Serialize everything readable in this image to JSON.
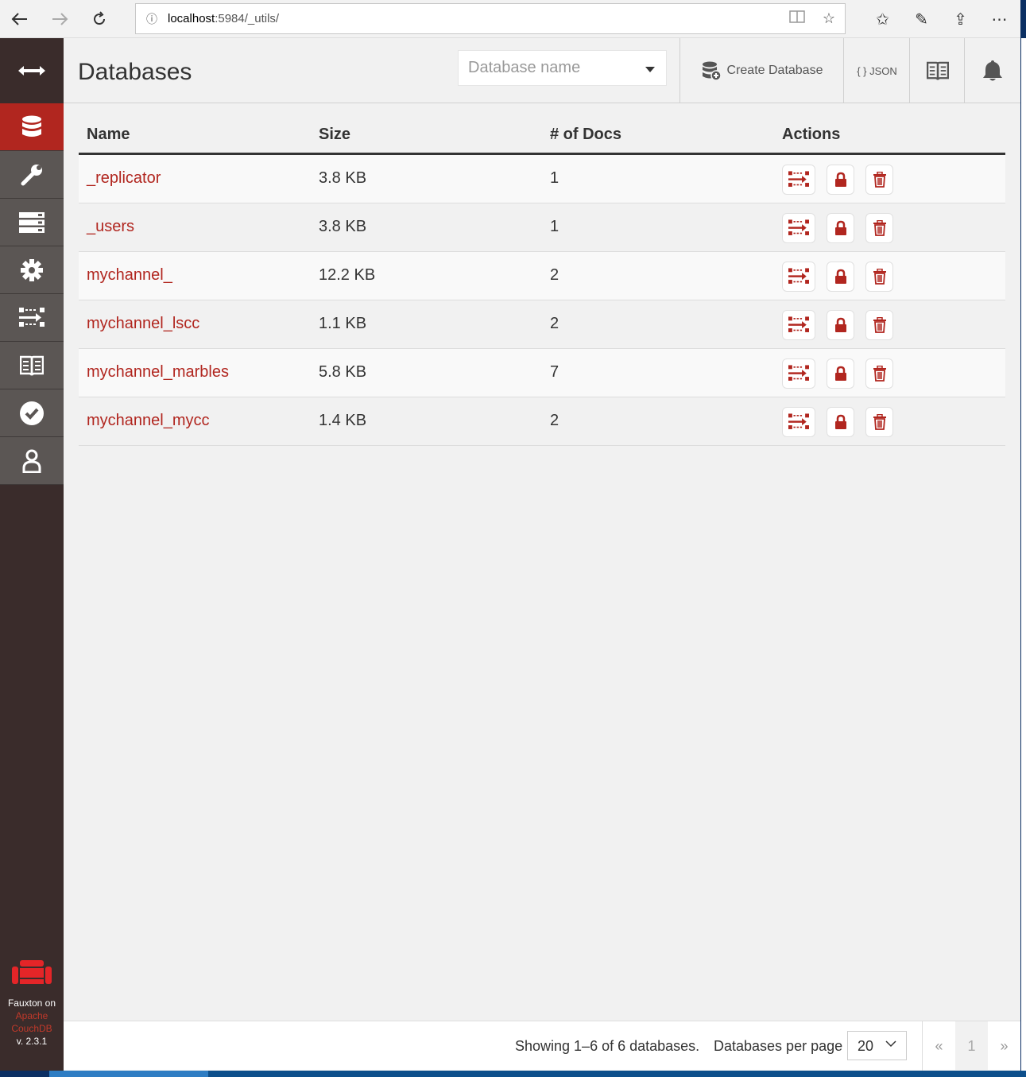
{
  "browser": {
    "url_host": "localhost",
    "url_path": ":5984/_utils/",
    "back_icon": "arrow-left-icon",
    "forward_icon": "arrow-right-icon",
    "refresh_icon": "refresh-icon"
  },
  "sidebar": {
    "items": [
      {
        "name": "databases",
        "icon": "database-icon",
        "active": true
      },
      {
        "name": "setup",
        "icon": "wrench-icon"
      },
      {
        "name": "active-tasks",
        "icon": "server-icon"
      },
      {
        "name": "config",
        "icon": "gear-icon"
      },
      {
        "name": "replication",
        "icon": "replication-icon"
      },
      {
        "name": "documentation",
        "icon": "book-icon"
      },
      {
        "name": "verify",
        "icon": "check-circle-icon"
      },
      {
        "name": "user",
        "icon": "user-icon"
      }
    ],
    "footer_line1": "Fauxton on",
    "footer_apache": "Apache",
    "footer_couchdb": "CouchDB",
    "footer_version": "v. 2.3.1"
  },
  "header": {
    "title": "Databases",
    "search_placeholder": "Database name",
    "create_label": "Create Database",
    "json_label": "{ } JSON"
  },
  "table": {
    "columns": [
      "Name",
      "Size",
      "# of Docs",
      "Actions"
    ],
    "rows": [
      {
        "name": "_replicator",
        "size": "3.8 KB",
        "docs": "1"
      },
      {
        "name": "_users",
        "size": "3.8 KB",
        "docs": "1"
      },
      {
        "name": "mychannel_",
        "size": "12.2 KB",
        "docs": "2"
      },
      {
        "name": "mychannel_lscc",
        "size": "1.1 KB",
        "docs": "2"
      },
      {
        "name": "mychannel_marbles",
        "size": "5.8 KB",
        "docs": "7"
      },
      {
        "name": "mychannel_mycc",
        "size": "1.4 KB",
        "docs": "2"
      }
    ]
  },
  "footer": {
    "showing": "Showing 1–6 of 6 databases.",
    "per_page_label": "Databases per page",
    "per_page_value": "20",
    "prev": "«",
    "page": "1",
    "next": "»"
  },
  "colors": {
    "accent": "#b1261f",
    "sidebar_bg": "#3a2c2b",
    "sidebar_item": "#5b5654"
  }
}
